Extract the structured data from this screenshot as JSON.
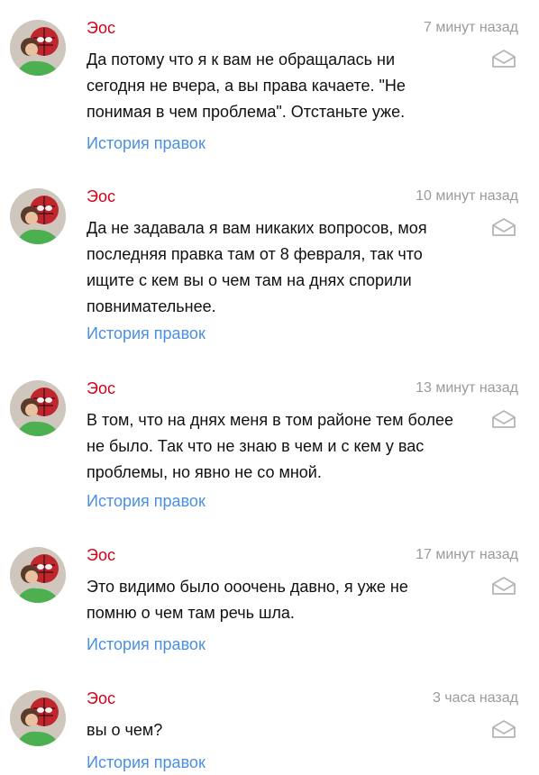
{
  "comments": [
    {
      "author": "Эос",
      "time": "7 минут назад",
      "text": "Да потому что я к вам не обращалась ни\nсегодня не вчера, а вы права качаете. \"Не\nпонимая в чем проблема\". Отстаньте уже.",
      "history_link": "История правок"
    },
    {
      "author": "Эос",
      "time": "10 минут назад",
      "text": "Да не задавала я вам никаких вопросов, моя\nпоследняя правка там от 8 февраля, так что\nищите с кем вы о чем там на днях спорили\nповнимательнее.",
      "history_link": "История правок"
    },
    {
      "author": "Эос",
      "time": "13 минут назад",
      "text": "В том, что на днях меня в том районе тем более\nне было. Так что не знаю в чем и с кем у вас\nпроблемы, но явно не со мной.",
      "history_link": "История правок"
    },
    {
      "author": "Эос",
      "time": "17 минут назад",
      "text": "Это видимо было ооочень давно, я уже не\nпомню о чем там речь шла.",
      "history_link": "История правок"
    },
    {
      "author": "Эос",
      "time": "3 часа назад",
      "text": "вы о чем?",
      "history_link": "История правок"
    }
  ],
  "icons": {
    "avatar": "avatar-photo",
    "reply": "envelope-icon"
  },
  "colors": {
    "author": "#d0021b",
    "link": "#4a90e2",
    "timestamp": "#9a9a9a",
    "text": "#111111"
  }
}
